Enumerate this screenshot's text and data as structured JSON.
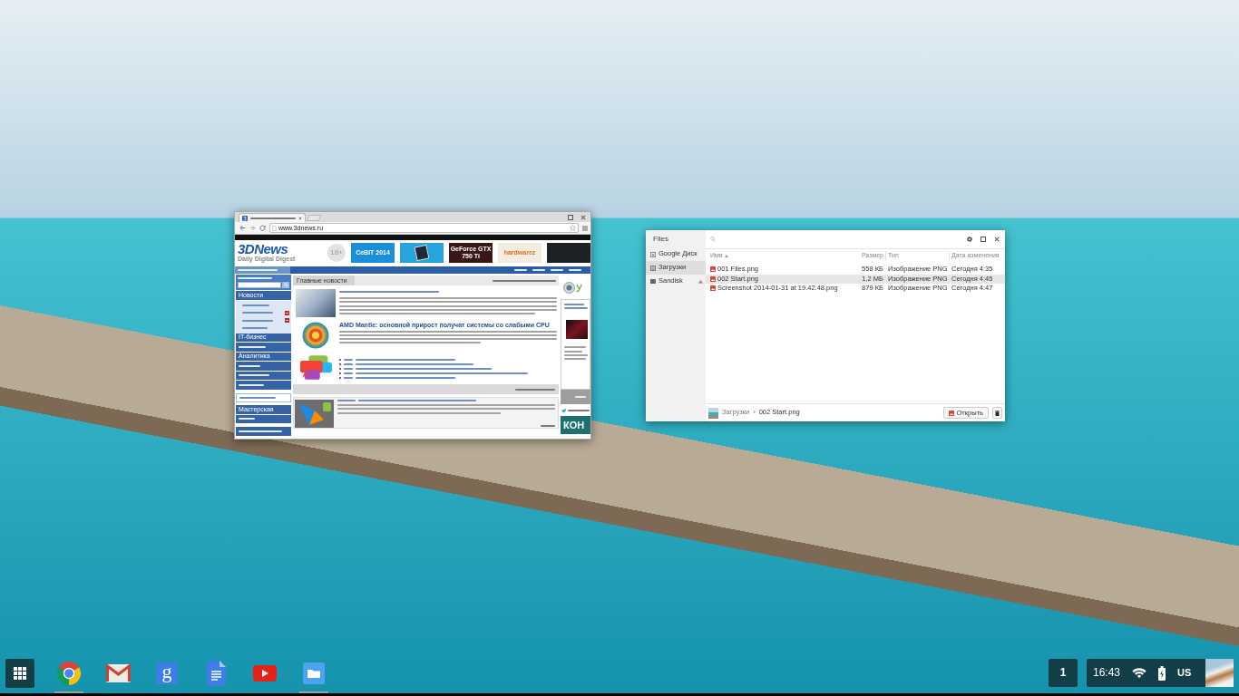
{
  "browser_window": {
    "tabs": [
      {
        "selected": true
      }
    ],
    "address": "www.3dnews.ru",
    "site": {
      "logo": "3DNews",
      "tagline": "Daily Digital Digest",
      "age_badge": "18+",
      "banners": [
        {
          "text": "CeBIT 2014",
          "color": "#1b8fd9"
        },
        {
          "color": "#27a4db"
        },
        {
          "text": "GeForce GTX 750 Ti",
          "color": "#3b1616"
        },
        {
          "text": "hardwarez",
          "color": "#f3ece0"
        },
        {
          "color": "#1d2226"
        }
      ],
      "menu": [
        {
          "items": [
            {
              "kind": "section",
              "label": "Новости",
              "children": [
                {
                  "badge": false
                },
                {
                  "badge": true
                },
                {
                  "badge": true
                },
                {
                  "badge": false
                }
              ]
            },
            {
              "kind": "section",
              "label": "IT-бизнес"
            },
            {
              "kind": "section"
            },
            {
              "kind": "section",
              "label": "Аналитика"
            },
            {
              "kind": "section"
            },
            {
              "kind": "section"
            },
            {
              "kind": "section"
            }
          ]
        },
        {
          "items": [
            {
              "kind": "plain"
            }
          ]
        },
        {
          "items": [
            {
              "kind": "section",
              "label": "Мастерская"
            },
            {
              "kind": "section"
            }
          ]
        },
        {
          "items": [
            {
              "kind": "section"
            }
          ]
        }
      ],
      "main": {
        "header": "Главные новости",
        "articles": [
          {
            "kind": "photo"
          },
          {
            "kind": "illustration",
            "title": "AMD Mantle: основной прирост получат системы со слабыми CPU"
          }
        ]
      },
      "side_widget": {
        "title": "У",
        "banner": "КОН"
      }
    }
  },
  "files_window": {
    "title": "Files",
    "places": [
      {
        "kind": "drive",
        "label": "Google Диск",
        "selected": false
      },
      {
        "kind": "folder",
        "label": "Загрузки",
        "selected": true
      },
      {
        "kind": "usb",
        "label": "Sandisk",
        "selected": false
      }
    ],
    "columns": [
      {
        "label": "Имя",
        "sorted": true
      },
      {
        "label": "Размер",
        "sorted": false
      },
      {
        "label": "Тип",
        "sorted": false
      },
      {
        "label": "Дата изменения",
        "sorted": false
      }
    ],
    "files": [
      {
        "name": "001 Files.png",
        "size": "558 КБ",
        "type": "Изображение PNG",
        "modified": "Сегодня 4:35",
        "selected": false
      },
      {
        "name": "002 Start.png",
        "size": "1,2 МБ",
        "type": "Изображение PNG",
        "modified": "Сегодня 4:45",
        "selected": true
      },
      {
        "name": "Screenshot 2014-01-31 at 19.42.48.png",
        "size": "879 КБ",
        "type": "Изображение PNG",
        "modified": "Сегодня 4:47",
        "selected": false
      }
    ],
    "path": [
      "Загрузки",
      "002 Start.png"
    ],
    "path_separator": "›",
    "open_button": "Открыть"
  },
  "shelf": {
    "apps": [
      {
        "kind": "browser",
        "running": true
      },
      {
        "kind": "mail",
        "running": false
      },
      {
        "kind": "search",
        "glyph": "g",
        "running": false
      },
      {
        "kind": "docs",
        "running": false
      },
      {
        "kind": "video",
        "running": false
      },
      {
        "kind": "files",
        "running": true
      }
    ],
    "notifications": "1",
    "time": "16:43",
    "keyboard": "US"
  }
}
